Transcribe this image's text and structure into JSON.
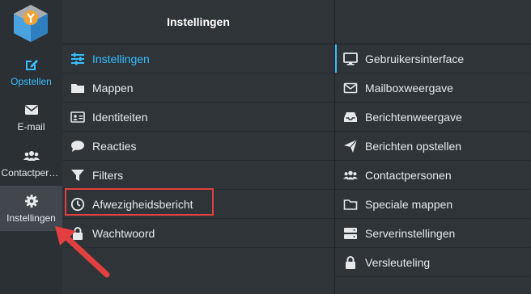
{
  "rail": {
    "items": [
      {
        "label": "Opstellen",
        "icon": "compose-icon"
      },
      {
        "label": "E-mail",
        "icon": "envelope-icon"
      },
      {
        "label": "Contactpersonen",
        "icon": "contacts-icon"
      },
      {
        "label": "Instellingen",
        "icon": "gear-icon"
      }
    ]
  },
  "settings": {
    "header": "Instellingen",
    "items": [
      {
        "label": "Instellingen",
        "icon": "sliders-icon"
      },
      {
        "label": "Mappen",
        "icon": "folder-icon"
      },
      {
        "label": "Identiteiten",
        "icon": "id-card-icon"
      },
      {
        "label": "Reacties",
        "icon": "speech-bubble-icon"
      },
      {
        "label": "Filters",
        "icon": "filter-icon"
      },
      {
        "label": "Afwezigheidsbericht",
        "icon": "clock-icon"
      },
      {
        "label": "Wachtwoord",
        "icon": "lock-icon"
      }
    ]
  },
  "sections": {
    "items": [
      {
        "label": "Gebruikersinterface",
        "icon": "monitor-icon"
      },
      {
        "label": "Mailboxweergave",
        "icon": "envelope-outline-icon"
      },
      {
        "label": "Berichtenweergave",
        "icon": "inbox-tray-icon"
      },
      {
        "label": "Berichten opstellen",
        "icon": "paper-plane-icon"
      },
      {
        "label": "Contactpersonen",
        "icon": "contacts-icon"
      },
      {
        "label": "Speciale mappen",
        "icon": "folder-outline-icon"
      },
      {
        "label": "Serverinstellingen",
        "icon": "server-icon"
      },
      {
        "label": "Versleuteling",
        "icon": "lock-icon"
      }
    ]
  },
  "colors": {
    "accent": "#37beff",
    "highlight": "#e2403f"
  }
}
